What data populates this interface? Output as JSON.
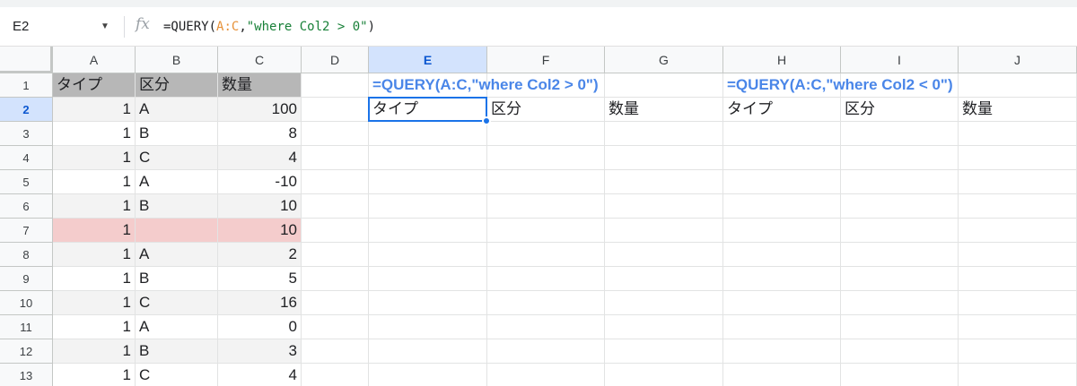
{
  "formula_bar": {
    "name_box": "E2",
    "fx_label": "fx",
    "formula_prefix": "=QUERY(",
    "formula_range": "A:C",
    "formula_comma": ",",
    "formula_string": "\"where Col2 > 0\"",
    "formula_suffix": ")"
  },
  "columns": [
    "A",
    "B",
    "C",
    "D",
    "E",
    "F",
    "G",
    "H",
    "I",
    "J"
  ],
  "rows": [
    "1",
    "2",
    "3",
    "4",
    "5",
    "6",
    "7",
    "8",
    "9",
    "10",
    "11",
    "12",
    "13"
  ],
  "active_cell": "E2",
  "colors": {
    "header_fill": "#b7b7b7",
    "band_fill": "#f3f3f3",
    "highlight_fill": "#f4cccc",
    "formula_text": "#4a86e8",
    "selection": "#1a73e8"
  },
  "source_table": {
    "headers": [
      "タイプ",
      "区分",
      "数量"
    ],
    "rows": [
      [
        "1",
        "A",
        "100"
      ],
      [
        "1",
        "B",
        "8"
      ],
      [
        "1",
        "C",
        "4"
      ],
      [
        "1",
        "A",
        "-10"
      ],
      [
        "1",
        "B",
        "10"
      ],
      [
        "1",
        "",
        "10"
      ],
      [
        "1",
        "A",
        "2"
      ],
      [
        "1",
        "B",
        "5"
      ],
      [
        "1",
        "C",
        "16"
      ],
      [
        "1",
        "A",
        "0"
      ],
      [
        "1",
        "B",
        "3"
      ],
      [
        "1",
        "C",
        "4"
      ]
    ]
  },
  "query_positive": {
    "formula_text": "=QUERY(A:C,\"where Col2 > 0\")",
    "headers": [
      "タイプ",
      "区分",
      "数量"
    ]
  },
  "query_negative": {
    "formula_text": "=QUERY(A:C,\"where Col2 < 0\")",
    "headers": [
      "タイプ",
      "区分",
      "数量"
    ]
  }
}
